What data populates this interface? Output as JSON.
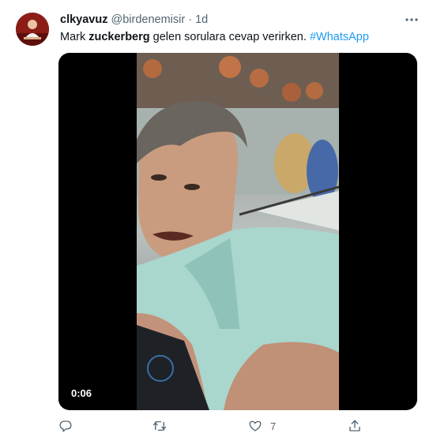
{
  "tweet": {
    "display_name": "clkyavuz",
    "handle": "@birdenemisir",
    "separator": "·",
    "time": "1d",
    "text": {
      "part1": "Mark ",
      "bold": "zuckerberg",
      "part2": " gelen sorulara cevap verirken. ",
      "hashtag": "#WhatsApp"
    },
    "video": {
      "duration": "0:06"
    },
    "actions": {
      "reply_count": "",
      "retweet_count": "",
      "like_count": "7"
    }
  },
  "icons": {
    "more": "more-dots-icon",
    "reply": "reply-icon",
    "retweet": "retweet-icon",
    "like": "heart-icon",
    "share": "share-icon"
  },
  "colors": {
    "link": "#1d9bf0",
    "secondary_text": "#536471",
    "video_background": "#000000"
  }
}
